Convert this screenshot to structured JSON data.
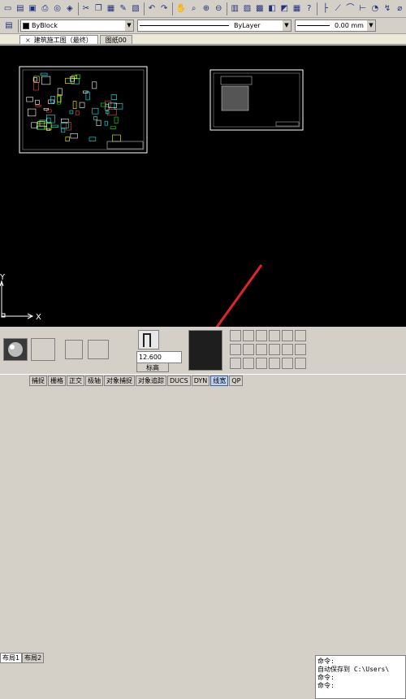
{
  "toolbar_icons": [
    "new-icon",
    "open-icon",
    "save-icon",
    "plot-icon",
    "preview-icon",
    "publish-icon",
    "cut-icon",
    "copy-icon",
    "paste-icon",
    "match-icon",
    "block-icon",
    "undo-icon",
    "redo-icon",
    "pan-icon",
    "zoom-realtime-icon",
    "zoom-window-icon",
    "zoom-previous-icon",
    "properties-icon",
    "design-center-icon",
    "tool-palette-icon",
    "sheet-set-icon",
    "markup-icon",
    "calculator-icon",
    "help-icon",
    "dim-linear-icon",
    "dim-aligned-icon",
    "dim-arc-icon",
    "dim-ordinate-icon",
    "dim-radius-icon",
    "dim-jogged-icon",
    "dim-diameter-icon"
  ],
  "props": {
    "color": "ByBlock",
    "linetype": "ByLayer",
    "lineweight": "0.00 mm"
  },
  "tabs": [
    {
      "label": "建筑施工图（最终）",
      "close": "×"
    },
    {
      "label": "图纸00",
      "close": ""
    }
  ],
  "layout_tabs": [
    "布局1",
    "布局2"
  ],
  "ucs": {
    "x": "X",
    "y": "Y"
  },
  "elevation": {
    "value": "12.600",
    "label": "标高"
  },
  "command": {
    "lines": [
      "命令:",
      "自动保存到 C:\\Users\\",
      "命令:",
      "命令:"
    ]
  },
  "status": [
    {
      "label": "捕捉",
      "on": false
    },
    {
      "label": "栅格",
      "on": false
    },
    {
      "label": "正交",
      "on": false
    },
    {
      "label": "极轴",
      "on": false
    },
    {
      "label": "对象捕捉",
      "on": false
    },
    {
      "label": "对象追踪",
      "on": false
    },
    {
      "label": "DUCS",
      "on": false
    },
    {
      "label": "DYN",
      "on": false
    },
    {
      "label": "线宽",
      "on": true
    },
    {
      "label": "QP",
      "on": false
    }
  ],
  "colors": {
    "canvas": "#000000",
    "arrow": "#e0242a",
    "drawing": "#ffffff"
  }
}
